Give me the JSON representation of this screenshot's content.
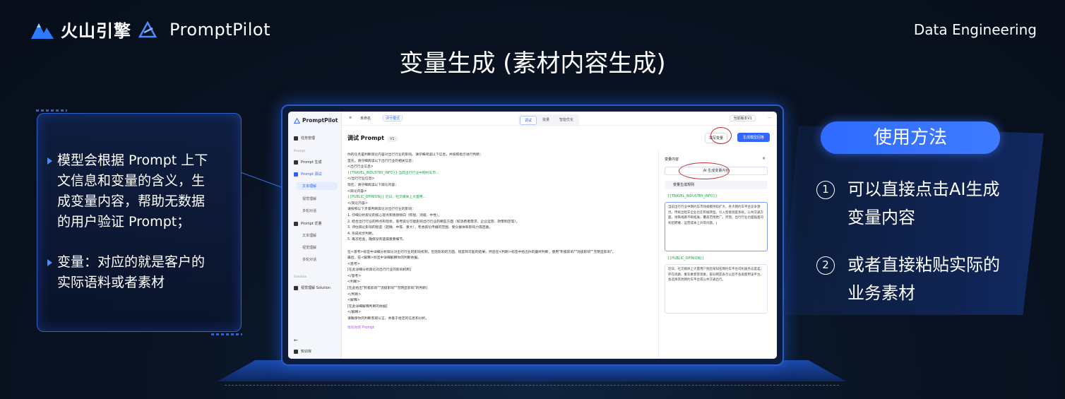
{
  "header": {
    "brand_name": "火山引擎",
    "brand_product": "PromptPilot",
    "section": "Data Engineering",
    "title": "变量生成 (素材内容生成)"
  },
  "left_card": {
    "bullet1": [
      "模型会根据 Prompt 上下",
      "文信息和变量的含义，生",
      "成变量内容，帮助无数据",
      "的用户验证 Prompt；"
    ],
    "bullet2": [
      "变量：对应的就是客户的",
      "实际语料或者素材"
    ]
  },
  "app": {
    "logo": "PromptPilot",
    "sidebar": {
      "task_manage": "任务管理",
      "group_prompt": "Prompt",
      "prompt_gen": "Prompt 生成",
      "prompt_debug": "Prompt 调试",
      "sub1": [
        "文本理解",
        "视觉理解",
        "多轮对话"
      ],
      "prompt_optimize": "Prompt 优量",
      "sub2": [
        "文本理解",
        "视觉理解",
        "多轮对话"
      ],
      "group_solution": "Solution",
      "solution_item": "视觉理解 Solution",
      "knowledge": "知识库"
    },
    "topbar": {
      "doc_name": "未命名",
      "eval_mode": "评分模式",
      "tabs": [
        "调试",
        "批量",
        "智能优化"
      ],
      "active_tab": "调试",
      "version": "当前版本V1"
    },
    "heading": "调试 Prompt",
    "heading_version": "V1",
    "write_var_button": "填写变量",
    "gen_button": "生成模型回答",
    "prompt_lines": [
      "你的任务是判断舆论内容对出行行业的影响。请仔细阅读以下信息，并按照指示进行判断：",
      "首先，请仔细阅读以下出行行业的相关信息：",
      "<出行行业信息>",
      "{{TRAVEL_INDUSTRY_INFO}} 当前出行行业中网约车市...",
      "</出行行业信息>",
      "现在，请仔细阅读以下舆论内容：",
      "<舆论内容>",
      "{{PUBLIC_OPINION}} 近日，社交媒体上大量用...",
      "</舆论内容>",
      "请按照以下步骤判断舆论对出行行业的影响：",
      "1. 仔细分析舆论的核心观点和情感倾向（积极、消极、中性）。",
      "2. 结合出行行业的特点和现状，思考舆论可能影响出行行业的哪些方面（如消费者需求、企业运营、政策制定等）。",
      "3. 评估舆论影响的程度（轻微、中等、重大），考虑舆论传播的范围、受众群体和影响力等因素。",
      "4. 形成初步判断。",
      "5. 再次检查，确保没有遗漏重要细节。",
      "",
      "在<思考>标签中详细分析舆论对出行行业的影响机制，包括影响的方面、程度和可能的结果。然后在<判断>标签中给出你的最终判断，使用\"积极影响\"\"消极影响\"\"无明显影响\"。",
      "最后，在<解释>标签中详细解释你的判断依据。",
      "<思考>",
      "[在此详细分析舆论对出行行业的影响机制]",
      "</思考>",
      "<判断>",
      "[在此给出\"积极影响\"\"消极影响\"\"无明显影响\"的判断]",
      "</判断>",
      "<解释>",
      "[在此详细解释判断的依据]",
      "</解释>",
      "请确保你的判断客观公正，并基于给定的信息和分析。"
    ],
    "optimize_link": "优化你的 Prompt",
    "panel": {
      "title": "变量内容",
      "ai_button": "AI 生成变量内容",
      "rule": "变量生成规则",
      "var1": "{{TRAVEL_INDUSTRY_INFO}}",
      "var1_text": "当前出行行业中网约车市场规模持续扩大，各大网约车平台竞争激烈。传统出租车企业也在积极转型，引入智能调度系统。公共交通方面，地铁线路不断拓展，覆盖范围更广。然而，出行行业也面临着司机招聘难、运营成本上升等问题。|",
      "var2": "{{PUBLIC_OPINION}}",
      "var2_text": "近日，社交媒体上大量用户抱怨某知名网约车平台司机服务态度差，存在绕路、乘车乘客等现象。部分网友表示以后不会再使用该平台，会选择其他网约车平台或公共交通出行。"
    }
  },
  "right": {
    "pill": "使用方法",
    "steps": [
      {
        "num": "1",
        "lines": [
          "可以直接点击AI生成",
          "变量内容"
        ]
      },
      {
        "num": "2",
        "lines": [
          "或者直接粘贴实际的",
          "业务素材"
        ]
      }
    ]
  }
}
